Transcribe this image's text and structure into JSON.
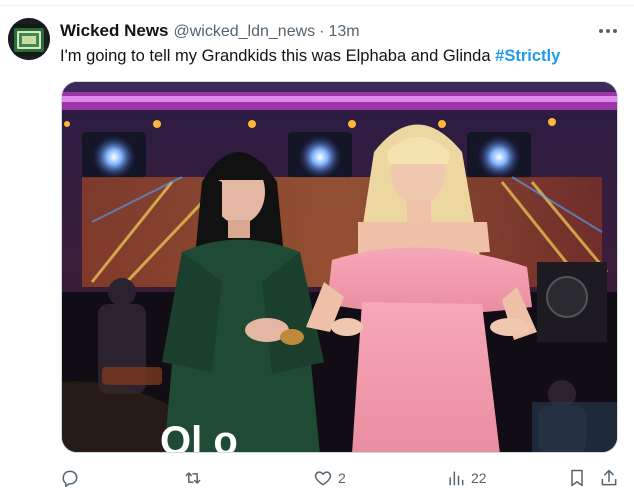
{
  "tweet": {
    "display_name": "Wicked News",
    "handle": "@wicked_ldn_news",
    "separator": "·",
    "time": "13m",
    "text": "I'm going to tell my Grandkids this was Elphaba and Glinda",
    "hashtag": "#Strictly"
  },
  "media": {
    "caption_fragment": "Ol   o"
  },
  "actions": {
    "reply_icon": "reply-icon",
    "retweet_icon": "retweet-icon",
    "like_icon": "heart-icon",
    "like_count": "2",
    "views_icon": "views-icon",
    "views_count": "22",
    "bookmark_icon": "bookmark-icon",
    "share_icon": "share-icon"
  },
  "colors": {
    "hashtag": "#1d9bf0",
    "secondary_text": "#536471",
    "primary_text": "#0f1419"
  }
}
